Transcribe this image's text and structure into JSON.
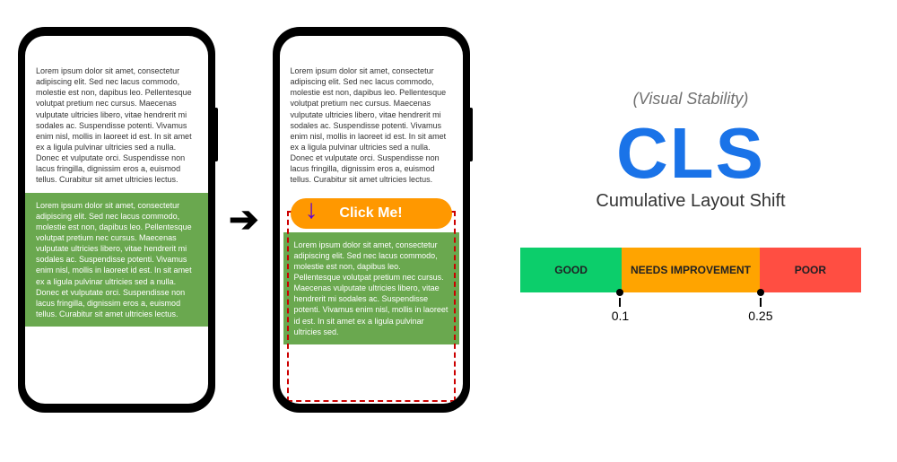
{
  "lorem_top": "Lorem ipsum dolor sit amet, consectetur adipiscing elit. Sed nec lacus commodo, molestie est non, dapibus leo. Pellentesque volutpat pretium nec cursus. Maecenas vulputate ultricies libero, vitae hendrerit mi sodales ac. Suspendisse potenti. Vivamus enim nisl, mollis in laoreet id est. In sit amet ex a ligula pulvinar ultricies sed a nulla. Donec et vulputate orci. Suspendisse non lacus fringilla, dignissim eros a, euismod tellus. Curabitur sit amet ultricies lectus.",
  "lorem_green": "Lorem ipsum dolor sit amet, consectetur adipiscing elit. Sed nec lacus commodo, molestie est non, dapibus leo. Pellentesque volutpat pretium nec cursus. Maecenas vulputate ultricies libero, vitae hendrerit mi sodales ac. Suspendisse potenti. Vivamus enim nisl, mollis in laoreet id est. In sit amet ex a ligula pulvinar ultricies sed a nulla. Donec et vulputate orci. Suspendisse non lacus fringilla, dignissim eros a, euismod tellus. Curabitur sit amet ultricies lectus.",
  "lorem_green_short": "Lorem ipsum dolor sit amet, consectetur adipiscing elit. Sed nec lacus commodo, molestie est non, dapibus leo. Pellentesque volutpat pretium nec cursus. Maecenas vulputate ultricies libero, vitae hendrerit mi sodales ac. Suspendisse potenti. Vivamus enim nisl, mollis in laoreet id est. In sit amet ex a ligula pulvinar ultricies sed.",
  "button_label": "Click Me!",
  "cls": {
    "tagline": "(Visual Stability)",
    "acronym": "CLS",
    "fullname": "Cumulative Layout Shift",
    "good": "GOOD",
    "mid": "NEEDS IMPROVEMENT",
    "poor": "POOR",
    "threshold1": "0.1",
    "threshold2": "0.25"
  },
  "colors": {
    "good": "#0cce6b",
    "mid": "#ffa400",
    "poor": "#ff4e42",
    "brand": "#1a73e8"
  }
}
